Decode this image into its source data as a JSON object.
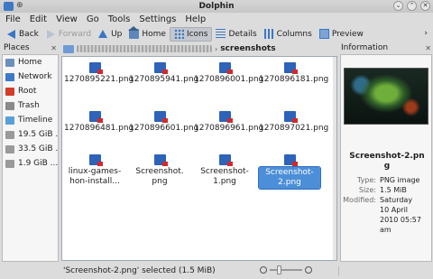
{
  "window": {
    "title": "Dolphin"
  },
  "menu": [
    "File",
    "Edit",
    "View",
    "Go",
    "Tools",
    "Settings",
    "Help"
  ],
  "toolbar": {
    "back": "Back",
    "forward": "Forward",
    "up": "Up",
    "home": "Home",
    "icons": "Icons",
    "details": "Details",
    "columns": "Columns",
    "preview": "Preview"
  },
  "places": {
    "title": "Places",
    "items": [
      {
        "label": "Home",
        "icon": "home-icon",
        "color": "#6d8fbe"
      },
      {
        "label": "Network",
        "icon": "network-icon",
        "color": "#3c7ac8"
      },
      {
        "label": "Root",
        "icon": "root-folder-icon",
        "color": "#d33b2a"
      },
      {
        "label": "Trash",
        "icon": "trash-icon",
        "color": "#8a8a8a"
      },
      {
        "label": "Timeline",
        "icon": "timeline-icon",
        "color": "#5aa0d8"
      },
      {
        "label": "19.5 GiB ...",
        "icon": "drive-icon",
        "color": "#9a9a9a"
      },
      {
        "label": "33.5 GiB ...",
        "icon": "drive-icon",
        "color": "#9a9a9a"
      },
      {
        "label": "1.9 GiB ...",
        "icon": "drive-icon",
        "color": "#9a9a9a"
      }
    ]
  },
  "path": {
    "current": "screenshots"
  },
  "files": [
    {
      "name": "1270895221.png"
    },
    {
      "name": "1270895941.png"
    },
    {
      "name": "1270896001.png"
    },
    {
      "name": "1270896181.png"
    },
    {
      "name": "1270896481.png"
    },
    {
      "name": "1270896601.png"
    },
    {
      "name": "1270896961.png"
    },
    {
      "name": "1270897021.png"
    },
    {
      "name": "linux-games-\nhon-install..."
    },
    {
      "name": "Screenshot.\npng"
    },
    {
      "name": "Screenshot-\n1.png"
    },
    {
      "name": "Screenshot-\n2.png",
      "selected": true
    }
  ],
  "info": {
    "title": "Information",
    "filename": "Screenshot-2.pn\ng",
    "type_label": "Type:",
    "type_value": "PNG image",
    "size_label": "Size:",
    "size_value": "1.5 MiB",
    "modified_label": "Modified:",
    "modified_value": "Saturday\n10 April\n2010 05:57\nam"
  },
  "status": {
    "text": "'Screenshot-2.png' selected (1.5 MiB)"
  }
}
